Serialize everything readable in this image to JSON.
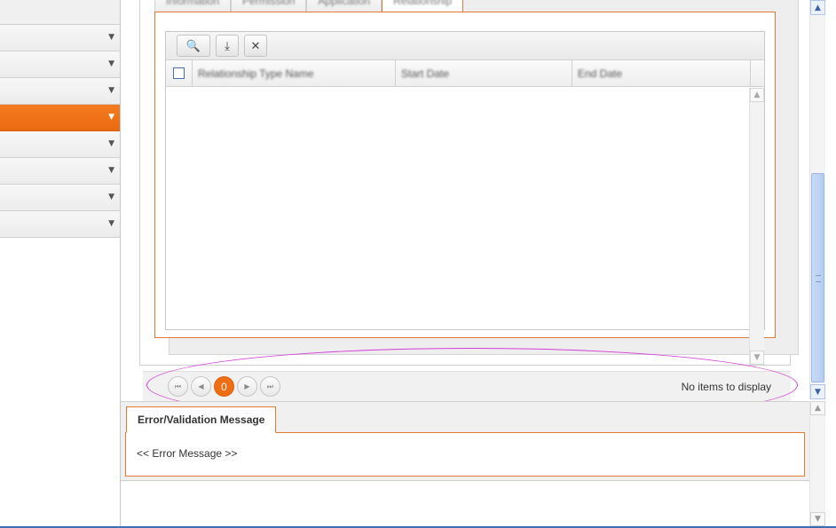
{
  "sidebar": {
    "items": [
      {
        "arrow": "▼",
        "active": false
      },
      {
        "arrow": "▼",
        "active": false
      },
      {
        "arrow": "▼",
        "active": false
      },
      {
        "arrow": "▼",
        "active": true
      },
      {
        "arrow": "▼",
        "active": false
      },
      {
        "arrow": "▼",
        "active": false
      },
      {
        "arrow": "▼",
        "active": false
      },
      {
        "arrow": "▼",
        "active": false
      }
    ]
  },
  "tabs": [
    "Information",
    "Permission",
    "Application",
    "Relationship"
  ],
  "toolbar": {
    "search_icon": "🔍",
    "export_icon": "⤓",
    "clear_icon": "✕"
  },
  "grid": {
    "columns": [
      "Relationship Type Name",
      "Start Date",
      "End Date"
    ]
  },
  "pager": {
    "first": "⏮",
    "prev": "◀",
    "current_page": "0",
    "next": "▶",
    "last": "⏭",
    "status": "No items to display"
  },
  "error": {
    "tab_label": "Error/Validation Message",
    "message": "<< Error Message >>"
  },
  "colors": {
    "accent": "#ef6d13",
    "annotation": "#d53cd8"
  }
}
